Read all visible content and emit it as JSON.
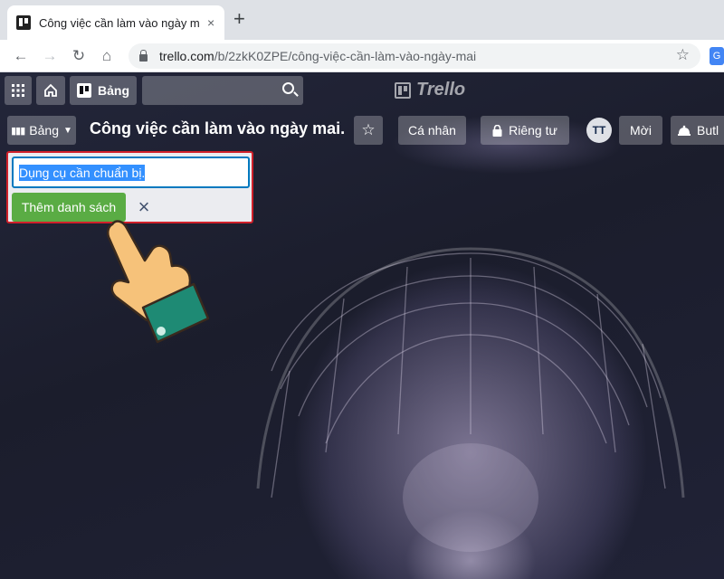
{
  "browser": {
    "tab_title": "Công việc cần làm vào ngày mai",
    "tab_close": "×",
    "new_tab": "+",
    "url_host": "trello.com",
    "url_path": "/b/2zkK0ZPE/công-việc-cần-làm-vào-ngày-mai",
    "extension_label": "G"
  },
  "trello_header": {
    "boards_button": "Bảng",
    "logo_text": "Trello"
  },
  "board_header": {
    "boards_menu": "Bảng",
    "title": "Công việc cần làm vào ngày mai.",
    "visibility_personal": "Cá nhân",
    "visibility_private": "Riêng tư",
    "avatar_initials": "TT",
    "invite": "Mời",
    "butler": "Butl"
  },
  "add_list": {
    "input_value": "Dụng cụ cần chuẩn bị.",
    "add_button": "Thêm danh sách",
    "close": "×"
  },
  "colors": {
    "highlight_border": "#d0202a",
    "add_button": "#5aac44",
    "input_focus": "#0079bf"
  }
}
